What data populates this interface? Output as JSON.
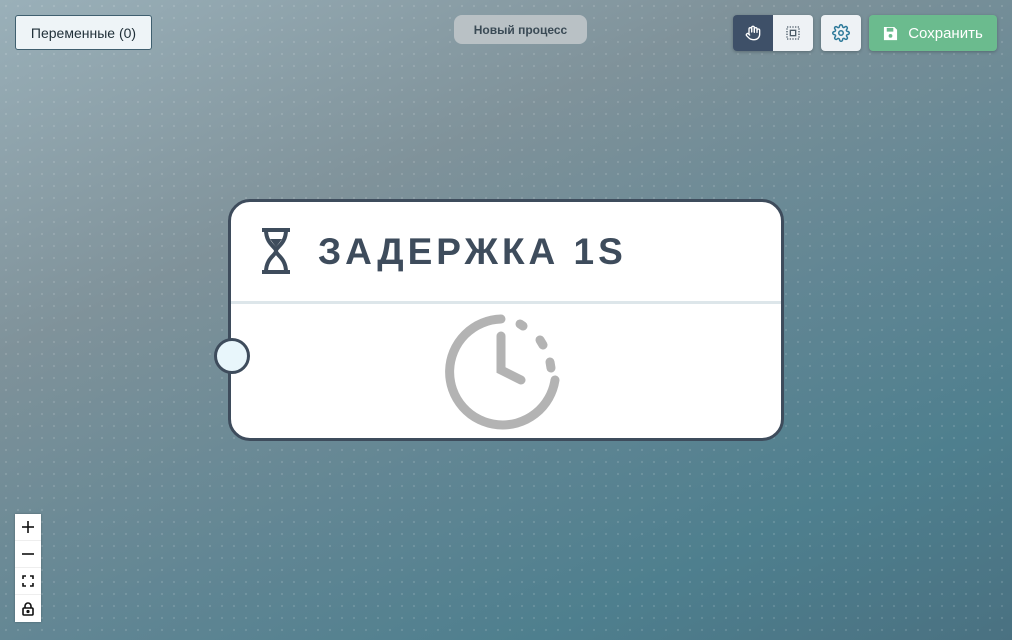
{
  "toolbar": {
    "variables_label": "Переменные (0)",
    "process_title": "Новый процесс",
    "save_label": "Сохранить",
    "save_color": "#6bbb8e",
    "active_tool_color": "#3e5068"
  },
  "node": {
    "title": "ЗАДЕРЖКА 1S",
    "header_icon": "hourglass-icon",
    "body_icon": "clock-icon",
    "border_color": "#3e4c5c"
  },
  "zoom_controls": [
    "zoom-in-icon",
    "zoom-out-icon",
    "fit-view-icon",
    "lock-icon"
  ]
}
